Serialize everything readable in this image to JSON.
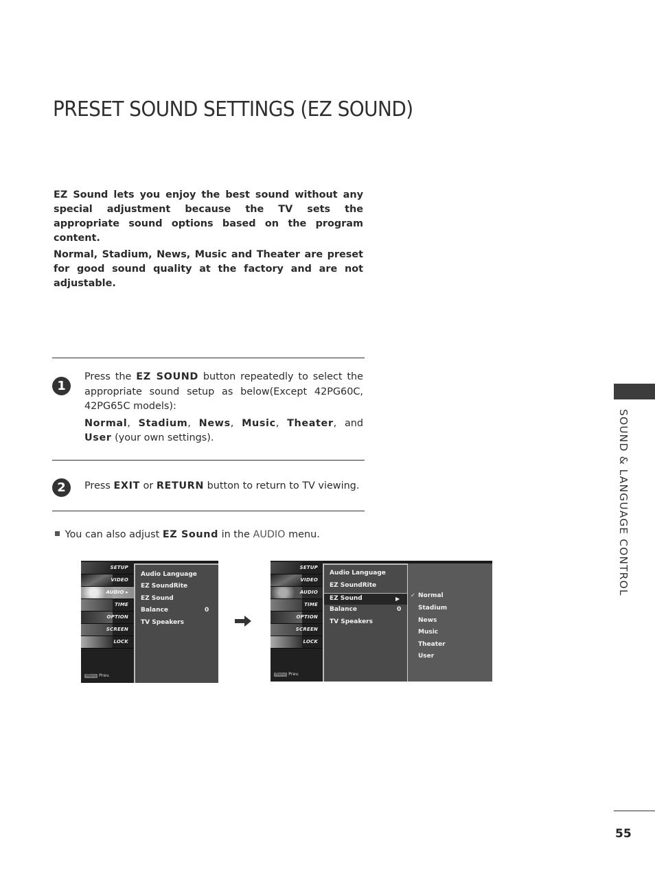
{
  "page": {
    "title": "PRESET SOUND SETTINGS (EZ SOUND)",
    "page_number": "55",
    "side_tab_label": "SOUND & LANGUAGE CONTROL"
  },
  "intro": {
    "p1": "EZ Sound lets you enjoy the best sound without any special adjustment because the TV sets the appropriate sound options based on the program content.",
    "p2": "Normal, Stadium, News, Music and Theater are preset for good sound quality at the factory and are not adjustable."
  },
  "steps": [
    {
      "number": "1",
      "t1": "Press the",
      "key": "EZ SOUND",
      "t2": "button repeatedly to select the appropriate sound setup as below(Except 42PG60C, 42PG65C models):",
      "options": [
        "Normal",
        "Stadium",
        "News",
        "Music",
        "Theater"
      ],
      "and": "and",
      "last_option": "User",
      "suffix": "(your own settings)."
    },
    {
      "number": "2",
      "t1": "Press",
      "key1": "EXIT",
      "or": "or",
      "key2": "RETURN",
      "t2": "button to return to TV viewing."
    }
  ],
  "note": {
    "t1": "You can also adjust",
    "key": "EZ Sound",
    "t2": "in the",
    "menu": "AUDIO",
    "t3": "menu."
  },
  "osd_menu": {
    "categories": [
      "SETUP",
      "VIDEO",
      "AUDIO",
      "TIME",
      "OPTION",
      "SCREEN",
      "LOCK"
    ],
    "active_category": "AUDIO",
    "footer_key": "Menu",
    "footer_label": "Prev.",
    "items": [
      {
        "label": "Audio Language",
        "value": ""
      },
      {
        "label": "EZ SoundRite",
        "value": ""
      },
      {
        "label": "EZ Sound",
        "value": ""
      },
      {
        "label": "Balance",
        "value": "0"
      },
      {
        "label": "TV Speakers",
        "value": ""
      }
    ],
    "submenu_arrow": "▶",
    "submenu": [
      "Normal",
      "Stadium",
      "News",
      "Music",
      "Theater",
      "User"
    ],
    "submenu_checked": "Normal",
    "check_glyph": "✓",
    "transition_arrow": "➡"
  }
}
